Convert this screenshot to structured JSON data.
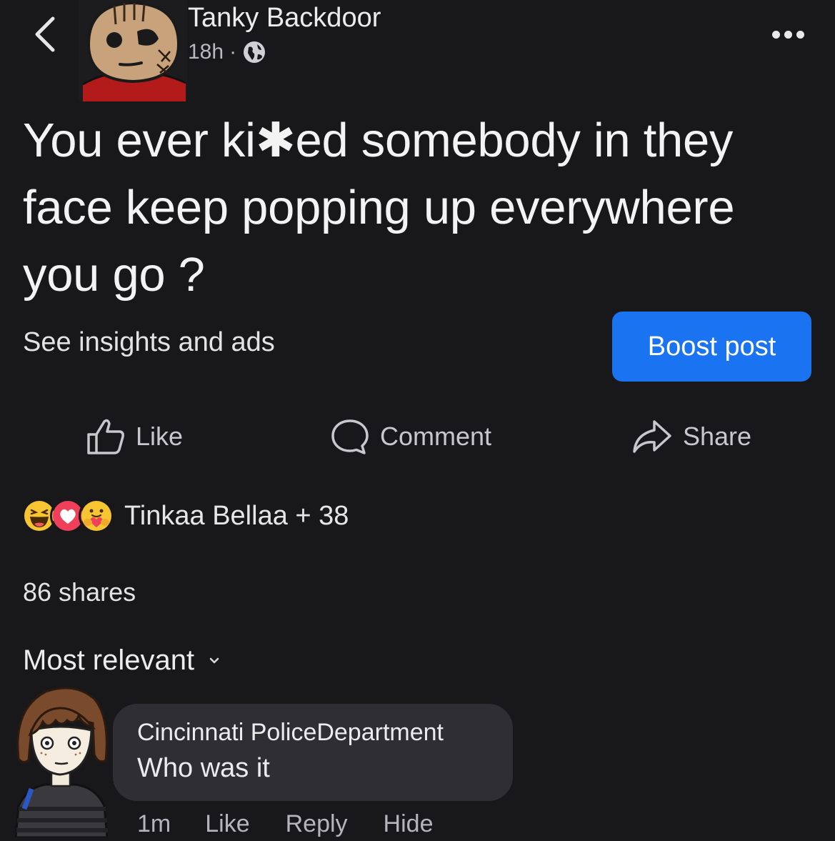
{
  "header": {
    "author": "Tanky Backdoor",
    "time": "18h",
    "separator": "·",
    "more_icon": "more-dots-icon",
    "back_icon": "chevron-left-icon",
    "privacy_icon": "globe-icon"
  },
  "post": {
    "text": "You ever ki✱ed somebody in they face keep popping up everywhere you go ?"
  },
  "insights_label": "See insights and ads",
  "boost_label": "Boost post",
  "actions": {
    "like": "Like",
    "comment": "Comment",
    "share": "Share"
  },
  "reactions": {
    "text": "Tinkaa Bellaa + 38",
    "icons": [
      "haha-icon",
      "love-icon",
      "care-icon"
    ]
  },
  "shares_text": "86 shares",
  "sort": {
    "label": "Most relevant",
    "icon": "chevron-down-icon"
  },
  "comment": {
    "author": "Cincinnati PoliceDepartment",
    "text": "Who was it",
    "time": "1m",
    "like": "Like",
    "reply": "Reply",
    "hide": "Hide"
  },
  "colors": {
    "background": "#18181b",
    "accent": "#1a73f0",
    "bubble": "#2e2e33"
  }
}
